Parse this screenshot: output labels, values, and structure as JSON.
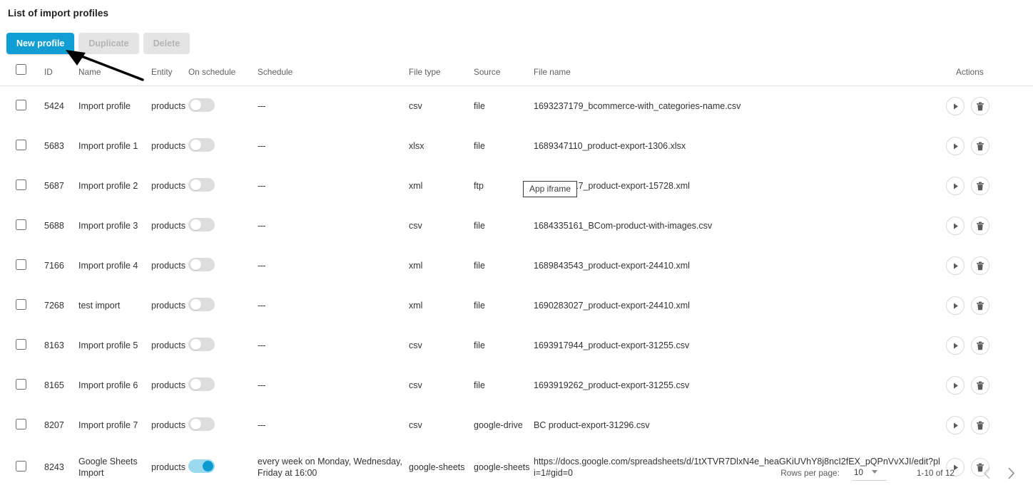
{
  "page": {
    "title": "List of import profiles",
    "app_iframe_label": "App iframe"
  },
  "toolbar": {
    "new_profile": "New profile",
    "duplicate": "Duplicate",
    "delete": "Delete"
  },
  "table": {
    "headers": {
      "id": "ID",
      "name": "Name",
      "entity": "Entity",
      "on_schedule": "On schedule",
      "schedule": "Schedule",
      "file_type": "File type",
      "source": "Source",
      "file_name": "File name",
      "actions": "Actions"
    },
    "rows": [
      {
        "id": "5424",
        "name": "Import profile",
        "entity": "products",
        "on_schedule": false,
        "schedule": "---",
        "file_type": "csv",
        "source": "file",
        "file_name": "1693237179_bcommerce-with_categories-name.csv"
      },
      {
        "id": "5683",
        "name": "Import profile 1",
        "entity": "products",
        "on_schedule": false,
        "schedule": "---",
        "file_type": "xlsx",
        "source": "file",
        "file_name": "1689347110_product-export-1306.xlsx"
      },
      {
        "id": "5687",
        "name": "Import profile 2",
        "entity": "products",
        "on_schedule": false,
        "schedule": "---",
        "file_type": "xml",
        "source": "ftp",
        "file_name": "1684332217_product-export-15728.xml"
      },
      {
        "id": "5688",
        "name": "Import profile 3",
        "entity": "products",
        "on_schedule": false,
        "schedule": "---",
        "file_type": "csv",
        "source": "file",
        "file_name": "1684335161_BCom-product-with-images.csv"
      },
      {
        "id": "7166",
        "name": "Import profile 4",
        "entity": "products",
        "on_schedule": false,
        "schedule": "---",
        "file_type": "xml",
        "source": "file",
        "file_name": "1689843543_product-export-24410.xml"
      },
      {
        "id": "7268",
        "name": "test import",
        "entity": "products",
        "on_schedule": false,
        "schedule": "---",
        "file_type": "xml",
        "source": "file",
        "file_name": "1690283027_product-export-24410.xml"
      },
      {
        "id": "8163",
        "name": "Import profile 5",
        "entity": "products",
        "on_schedule": false,
        "schedule": "---",
        "file_type": "csv",
        "source": "file",
        "file_name": "1693917944_product-export-31255.csv"
      },
      {
        "id": "8165",
        "name": "Import profile 6",
        "entity": "products",
        "on_schedule": false,
        "schedule": "---",
        "file_type": "csv",
        "source": "file",
        "file_name": "1693919262_product-export-31255.csv"
      },
      {
        "id": "8207",
        "name": "Import profile 7",
        "entity": "products",
        "on_schedule": false,
        "schedule": "---",
        "file_type": "csv",
        "source": "google-drive",
        "file_name": "BC product-export-31296.csv"
      },
      {
        "id": "8243",
        "name": "Google Sheets Import",
        "entity": "products",
        "on_schedule": true,
        "schedule": "every week on Monday, Wednesday, Friday at 16:00",
        "file_type": "google-sheets",
        "source": "google-sheets",
        "file_name": "https://docs.google.com/spreadsheets/d/1tXTVR7DlxN4e_heaGKiUVhY8j8ncI2fEX_pQPnVvXJI/edit?pli=1#gid=0"
      }
    ]
  },
  "pagination": {
    "rows_per_page_label": "Rows per page:",
    "rows_per_page_value": "10",
    "range": "1-10 of 12"
  },
  "colors": {
    "primary": "#119ed4",
    "toggle_on_track": "#9ad9ee",
    "toggle_on_knob": "#0b9bd0",
    "toggle_off_track": "#dddddd",
    "disabled_button": "#e4e4e4"
  }
}
